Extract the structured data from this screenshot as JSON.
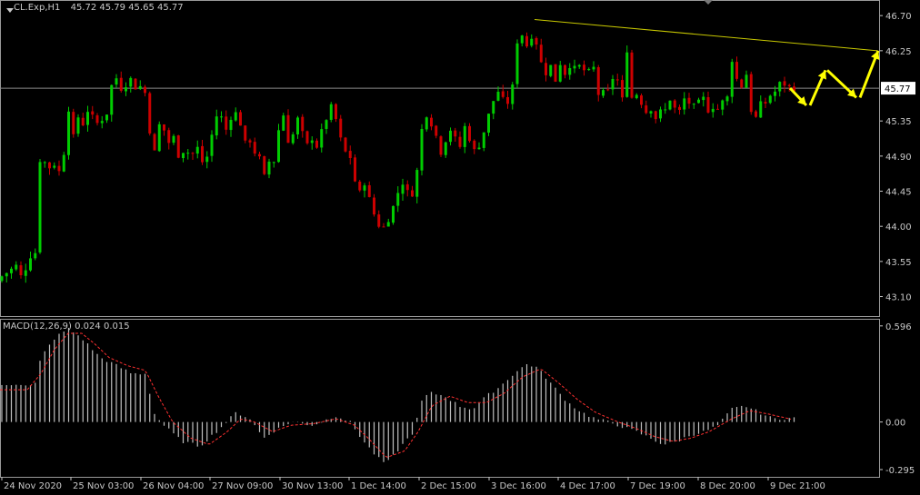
{
  "header": {
    "symbol": "CL.Exp,H1",
    "ohlc": "45.72 45.79 45.65 45.77"
  },
  "colors": {
    "background": "#000000",
    "bull": "#00cc00",
    "bear": "#cc0000",
    "grid_line": "#8a8a8a",
    "trend_line": "#c8c800",
    "arrows": "#ffff00",
    "price_tag_bg": "#ffffff",
    "macd_hist": "#c0c0c0",
    "macd_signal": "#ff3030",
    "axis_text": "#c8c8c8"
  },
  "chart_data": [
    {
      "type": "candlestick",
      "title": "CL.Exp,H1",
      "timeframe": "H1",
      "price_axis_ticks": [
        "46.70",
        "46.25",
        "45.77",
        "45.35",
        "44.90",
        "44.45",
        "44.00",
        "43.55",
        "43.10"
      ],
      "ylim": [
        42.85,
        46.9
      ],
      "current_price": 45.77,
      "time_axis_labels": [
        "24 Nov 2020",
        "25 Nov 03:00",
        "26 Nov 04:00",
        "27 Nov 09:00",
        "30 Nov 13:00",
        "1 Dec 14:00",
        "2 Dec 15:00",
        "3 Dec 16:00",
        "4 Dec 17:00",
        "7 Dec 19:00",
        "8 Dec 20:00",
        "9 Dec 21:00"
      ],
      "close_path": [
        [
          0,
          43.3
        ],
        [
          5,
          43.45
        ],
        [
          10,
          43.35
        ],
        [
          15,
          43.55
        ],
        [
          20,
          43.45
        ],
        [
          25,
          43.3
        ],
        [
          30,
          43.55
        ],
        [
          35,
          43.65
        ],
        [
          38,
          43.4
        ],
        [
          42,
          44.8
        ],
        [
          46,
          44.9
        ],
        [
          50,
          44.8
        ],
        [
          55,
          44.75
        ],
        [
          60,
          44.8
        ],
        [
          65,
          44.7
        ],
        [
          70,
          44.9
        ],
        [
          74,
          45.6
        ],
        [
          78,
          45.35
        ],
        [
          82,
          45.05
        ],
        [
          86,
          45.4
        ],
        [
          90,
          45.25
        ],
        [
          95,
          45.5
        ],
        [
          100,
          45.45
        ],
        [
          105,
          45.3
        ],
        [
          110,
          45.35
        ],
        [
          115,
          45.4
        ],
        [
          120,
          45.5
        ],
        [
          125,
          46.05
        ],
        [
          130,
          45.8
        ],
        [
          135,
          45.75
        ],
        [
          140,
          45.85
        ],
        [
          145,
          45.9
        ],
        [
          150,
          45.75
        ],
        [
          155,
          45.8
        ],
        [
          160,
          45.7
        ],
        [
          165,
          45.2
        ],
        [
          170,
          44.95
        ],
        [
          175,
          45.3
        ],
        [
          180,
          45.25
        ],
        [
          185,
          45.05
        ],
        [
          190,
          45.2
        ],
        [
          195,
          44.9
        ],
        [
          200,
          44.95
        ],
        [
          205,
          45.0
        ],
        [
          210,
          44.85
        ],
        [
          215,
          45.05
        ],
        [
          220,
          44.95
        ],
        [
          225,
          44.7
        ],
        [
          230,
          45.05
        ],
        [
          235,
          45.25
        ],
        [
          240,
          45.5
        ],
        [
          245,
          45.35
        ],
        [
          250,
          45.2
        ],
        [
          255,
          45.45
        ],
        [
          260,
          45.45
        ],
        [
          265,
          45.3
        ],
        [
          270,
          45.05
        ],
        [
          275,
          45.1
        ],
        [
          280,
          44.95
        ],
        [
          285,
          44.9
        ],
        [
          290,
          44.6
        ],
        [
          295,
          44.85
        ],
        [
          300,
          44.75
        ],
        [
          305,
          45.1
        ],
        [
          310,
          45.55
        ],
        [
          315,
          45.2
        ],
        [
          320,
          44.95
        ],
        [
          325,
          45.45
        ],
        [
          330,
          45.3
        ],
        [
          335,
          45.1
        ],
        [
          340,
          45.0
        ],
        [
          345,
          45.2
        ],
        [
          350,
          44.95
        ],
        [
          355,
          45.3
        ],
        [
          360,
          45.4
        ],
        [
          365,
          45.55
        ],
        [
          370,
          45.35
        ],
        [
          375,
          45.1
        ],
        [
          380,
          44.95
        ],
        [
          385,
          44.9
        ],
        [
          390,
          44.6
        ],
        [
          395,
          44.4
        ],
        [
          400,
          44.6
        ],
        [
          405,
          44.4
        ],
        [
          410,
          44.2
        ],
        [
          415,
          44.05
        ],
        [
          420,
          43.95
        ],
        [
          425,
          44.05
        ],
        [
          430,
          44.15
        ],
        [
          435,
          44.35
        ],
        [
          440,
          44.5
        ],
        [
          445,
          44.6
        ],
        [
          450,
          44.35
        ],
        [
          455,
          44.45
        ],
        [
          460,
          44.8
        ],
        [
          465,
          45.35
        ],
        [
          470,
          45.45
        ],
        [
          475,
          45.3
        ],
        [
          480,
          45.15
        ],
        [
          485,
          44.95
        ],
        [
          490,
          45.1
        ],
        [
          495,
          45.25
        ],
        [
          500,
          45.15
        ],
        [
          505,
          44.95
        ],
        [
          510,
          45.3
        ],
        [
          515,
          45.2
        ],
        [
          520,
          44.95
        ],
        [
          525,
          45.0
        ],
        [
          530,
          45.1
        ],
        [
          535,
          45.35
        ],
        [
          540,
          45.5
        ],
        [
          545,
          45.7
        ],
        [
          550,
          45.75
        ],
        [
          555,
          45.55
        ],
        [
          560,
          45.6
        ],
        [
          565,
          45.85
        ],
        [
          570,
          46.5
        ],
        [
          575,
          46.45
        ],
        [
          580,
          46.3
        ],
        [
          585,
          46.45
        ],
        [
          590,
          46.35
        ],
        [
          595,
          46.1
        ],
        [
          600,
          45.95
        ],
        [
          605,
          46.1
        ],
        [
          610,
          45.8
        ],
        [
          615,
          46.15
        ],
        [
          620,
          45.9
        ],
        [
          625,
          46.1
        ],
        [
          630,
          46.0
        ],
        [
          635,
          46.05
        ],
        [
          640,
          46.05
        ],
        [
          645,
          45.95
        ],
        [
          650,
          46.0
        ],
        [
          655,
          46.05
        ],
        [
          660,
          45.5
        ],
        [
          665,
          45.8
        ],
        [
          670,
          45.7
        ],
        [
          675,
          45.95
        ],
        [
          680,
          45.85
        ],
        [
          685,
          45.6
        ],
        [
          690,
          46.3
        ],
        [
          695,
          45.65
        ],
        [
          700,
          45.7
        ],
        [
          705,
          45.6
        ],
        [
          710,
          45.45
        ],
        [
          715,
          45.55
        ],
        [
          720,
          45.35
        ],
        [
          725,
          45.5
        ],
        [
          730,
          45.4
        ],
        [
          735,
          45.65
        ],
        [
          740,
          45.6
        ],
        [
          745,
          45.4
        ],
        [
          750,
          45.55
        ],
        [
          755,
          45.7
        ],
        [
          760,
          45.5
        ],
        [
          765,
          45.55
        ],
        [
          770,
          45.6
        ],
        [
          775,
          45.65
        ],
        [
          780,
          45.45
        ],
        [
          785,
          45.55
        ],
        [
          790,
          45.5
        ],
        [
          795,
          45.6
        ],
        [
          800,
          45.65
        ],
        [
          805,
          46.15
        ],
        [
          810,
          45.9
        ],
        [
          815,
          45.75
        ],
        [
          820,
          46.05
        ],
        [
          825,
          45.55
        ],
        [
          830,
          45.3
        ],
        [
          835,
          45.6
        ],
        [
          840,
          45.5
        ],
        [
          845,
          45.7
        ],
        [
          850,
          45.65
        ],
        [
          855,
          45.8
        ],
        [
          860,
          45.85
        ],
        [
          865,
          45.8
        ],
        [
          870,
          45.77
        ]
      ],
      "trend_line": {
        "from": [
          "3 Dec 16:00",
          46.65
        ],
        "to": [
          "future",
          46.25
        ],
        "color": "#c8c800"
      },
      "forecast_arrows": [
        [
          45.77,
          45.55
        ],
        [
          45.55,
          46.0
        ],
        [
          46.0,
          45.65
        ],
        [
          45.65,
          46.25
        ]
      ]
    },
    {
      "type": "bar",
      "title": "MACD(12,26,9)",
      "main_value": "0.024",
      "signal_value": "0.015",
      "axis_ticks": [
        "0.596",
        "0.00",
        "-0.295"
      ],
      "ylim": [
        -0.34,
        0.64
      ],
      "histogram_path": [
        [
          0,
          0.22
        ],
        [
          20,
          0.24
        ],
        [
          38,
          0.22
        ],
        [
          45,
          0.4
        ],
        [
          60,
          0.52
        ],
        [
          75,
          0.58
        ],
        [
          90,
          0.52
        ],
        [
          110,
          0.4
        ],
        [
          125,
          0.36
        ],
        [
          145,
          0.3
        ],
        [
          160,
          0.3
        ],
        [
          170,
          0.05
        ],
        [
          180,
          -0.02
        ],
        [
          200,
          -0.12
        ],
        [
          220,
          -0.15
        ],
        [
          240,
          -0.05
        ],
        [
          260,
          0.06
        ],
        [
          275,
          0.02
        ],
        [
          290,
          -0.1
        ],
        [
          300,
          -0.06
        ],
        [
          320,
          0.0
        ],
        [
          345,
          -0.02
        ],
        [
          370,
          0.04
        ],
        [
          385,
          0.0
        ],
        [
          400,
          -0.12
        ],
        [
          415,
          -0.22
        ],
        [
          425,
          -0.26
        ],
        [
          440,
          -0.16
        ],
        [
          455,
          -0.06
        ],
        [
          465,
          0.15
        ],
        [
          475,
          0.18
        ],
        [
          490,
          0.16
        ],
        [
          505,
          0.1
        ],
        [
          520,
          0.08
        ],
        [
          535,
          0.16
        ],
        [
          550,
          0.22
        ],
        [
          565,
          0.3
        ],
        [
          580,
          0.36
        ],
        [
          590,
          0.34
        ],
        [
          600,
          0.28
        ],
        [
          615,
          0.18
        ],
        [
          625,
          0.12
        ],
        [
          640,
          0.06
        ],
        [
          655,
          0.02
        ],
        [
          670,
          0.0
        ],
        [
          690,
          -0.04
        ],
        [
          700,
          -0.06
        ],
        [
          715,
          -0.1
        ],
        [
          730,
          -0.14
        ],
        [
          745,
          -0.12
        ],
        [
          760,
          -0.08
        ],
        [
          775,
          -0.06
        ],
        [
          790,
          -0.02
        ],
        [
          805,
          0.08
        ],
        [
          820,
          0.1
        ],
        [
          835,
          0.06
        ],
        [
          850,
          0.02
        ],
        [
          872,
          0.024
        ]
      ],
      "signal_path": [
        [
          0,
          0.2
        ],
        [
          30,
          0.2
        ],
        [
          45,
          0.3
        ],
        [
          60,
          0.45
        ],
        [
          75,
          0.55
        ],
        [
          90,
          0.55
        ],
        [
          105,
          0.48
        ],
        [
          120,
          0.4
        ],
        [
          140,
          0.35
        ],
        [
          160,
          0.32
        ],
        [
          175,
          0.15
        ],
        [
          190,
          0.0
        ],
        [
          210,
          -0.1
        ],
        [
          230,
          -0.14
        ],
        [
          250,
          -0.06
        ],
        [
          265,
          0.02
        ],
        [
          280,
          0.0
        ],
        [
          300,
          -0.06
        ],
        [
          320,
          -0.02
        ],
        [
          345,
          -0.01
        ],
        [
          370,
          0.02
        ],
        [
          390,
          -0.02
        ],
        [
          405,
          -0.1
        ],
        [
          425,
          -0.22
        ],
        [
          445,
          -0.18
        ],
        [
          460,
          -0.06
        ],
        [
          475,
          0.1
        ],
        [
          495,
          0.16
        ],
        [
          515,
          0.12
        ],
        [
          535,
          0.12
        ],
        [
          555,
          0.18
        ],
        [
          575,
          0.28
        ],
        [
          595,
          0.33
        ],
        [
          615,
          0.24
        ],
        [
          635,
          0.14
        ],
        [
          655,
          0.06
        ],
        [
          680,
          0.0
        ],
        [
          700,
          -0.04
        ],
        [
          720,
          -0.09
        ],
        [
          740,
          -0.12
        ],
        [
          760,
          -0.1
        ],
        [
          780,
          -0.06
        ],
        [
          805,
          0.02
        ],
        [
          825,
          0.07
        ],
        [
          845,
          0.05
        ],
        [
          872,
          0.015
        ]
      ]
    }
  ]
}
